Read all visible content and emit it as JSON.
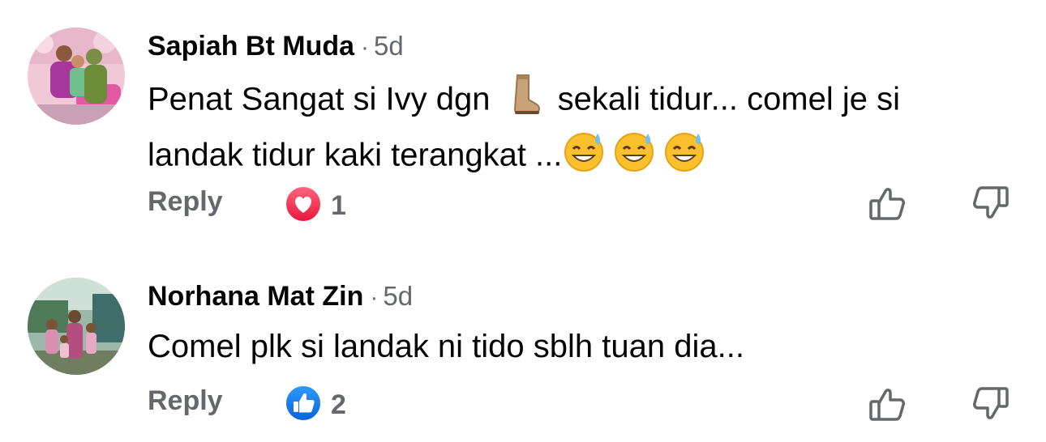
{
  "comments": [
    {
      "author": "Sapiah Bt Muda",
      "time": "5d",
      "text_part1": "Penat Sangat si Ivy dgn",
      "text_part2": "sekali tidur... comel je si",
      "text_line2": "landak tidur kaki terangkat ...",
      "emojis": [
        "boot-emoji",
        "sweat-smile-emoji",
        "sweat-smile-emoji",
        "sweat-smile-emoji"
      ],
      "reply_label": "Reply",
      "reaction": {
        "type": "love",
        "count": "1",
        "color": "#f33e58"
      }
    },
    {
      "author": "Norhana Mat Zin",
      "time": "5d",
      "text": "Comel plk si landak ni tido sblh tuan dia...",
      "reply_label": "Reply",
      "reaction": {
        "type": "like",
        "count": "2",
        "color": "#1877f2"
      }
    }
  ],
  "separator": "·",
  "colors": {
    "secondary_text": "#65676b",
    "primary_text": "#050505"
  }
}
